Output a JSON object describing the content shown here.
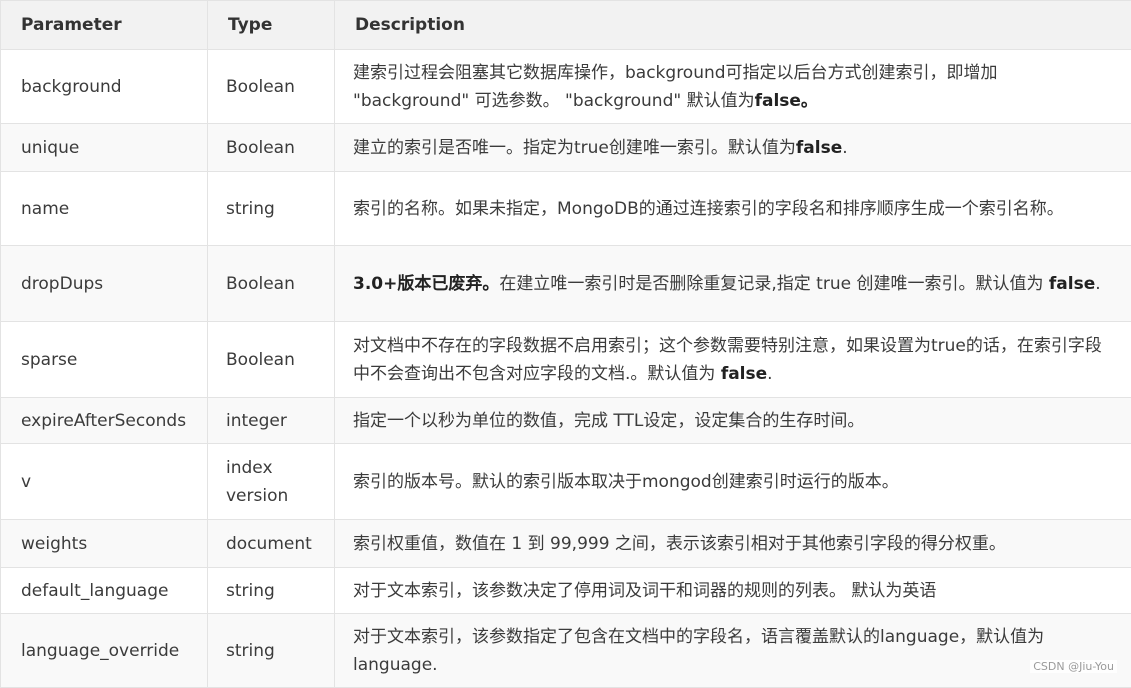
{
  "headers": {
    "parameter": "Parameter",
    "type": "Type",
    "description": "Description"
  },
  "rows": [
    {
      "parameter": "background",
      "type": "Boolean",
      "desc_pre": "建索引过程会阻塞其它数据库操作，background可指定以后台方式创建索引，即增加 \"background\" 可选参数。 \"background\" 默认值为",
      "desc_bold": "false。",
      "desc_post": ""
    },
    {
      "parameter": "unique",
      "type": "Boolean",
      "desc_pre": "建立的索引是否唯一。指定为true创建唯一索引。默认值为",
      "desc_bold": "false",
      "desc_post": "."
    },
    {
      "parameter": "name",
      "type": "string",
      "desc_pre": "索引的名称。如果未指定，MongoDB的通过连接索引的字段名和排序顺序生成一个索引名称。",
      "desc_bold": "",
      "desc_post": ""
    },
    {
      "parameter": "dropDups",
      "type": "Boolean",
      "desc_lead_bold": "3.0+版本已废弃。",
      "desc_pre": "在建立唯一索引时是否删除重复记录,指定 true 创建唯一索引。默认值为 ",
      "desc_bold": "false",
      "desc_post": "."
    },
    {
      "parameter": "sparse",
      "type": "Boolean",
      "desc_pre": "对文档中不存在的字段数据不启用索引；这个参数需要特别注意，如果设置为true的话，在索引字段中不会查询出不包含对应字段的文档.。默认值为 ",
      "desc_bold": "false",
      "desc_post": "."
    },
    {
      "parameter": "expireAfterSeconds",
      "type": "integer",
      "desc_pre": "指定一个以秒为单位的数值，完成 TTL设定，设定集合的生存时间。",
      "desc_bold": "",
      "desc_post": ""
    },
    {
      "parameter": "v",
      "type": "index version",
      "desc_pre": "索引的版本号。默认的索引版本取决于mongod创建索引时运行的版本。",
      "desc_bold": "",
      "desc_post": ""
    },
    {
      "parameter": "weights",
      "type": "document",
      "desc_pre": "索引权重值，数值在 1 到 99,999 之间，表示该索引相对于其他索引字段的得分权重。",
      "desc_bold": "",
      "desc_post": ""
    },
    {
      "parameter": "default_language",
      "type": "string",
      "desc_pre": "对于文本索引，该参数决定了停用词及词干和词器的规则的列表。 默认为英语",
      "desc_bold": "",
      "desc_post": ""
    },
    {
      "parameter": "language_override",
      "type": "string",
      "desc_pre": "对于文本索引，该参数指定了包含在文档中的字段名，语言覆盖默认的language，默认值为 language.",
      "desc_bold": "",
      "desc_post": ""
    }
  ],
  "watermark": "CSDN @Jiu-You"
}
